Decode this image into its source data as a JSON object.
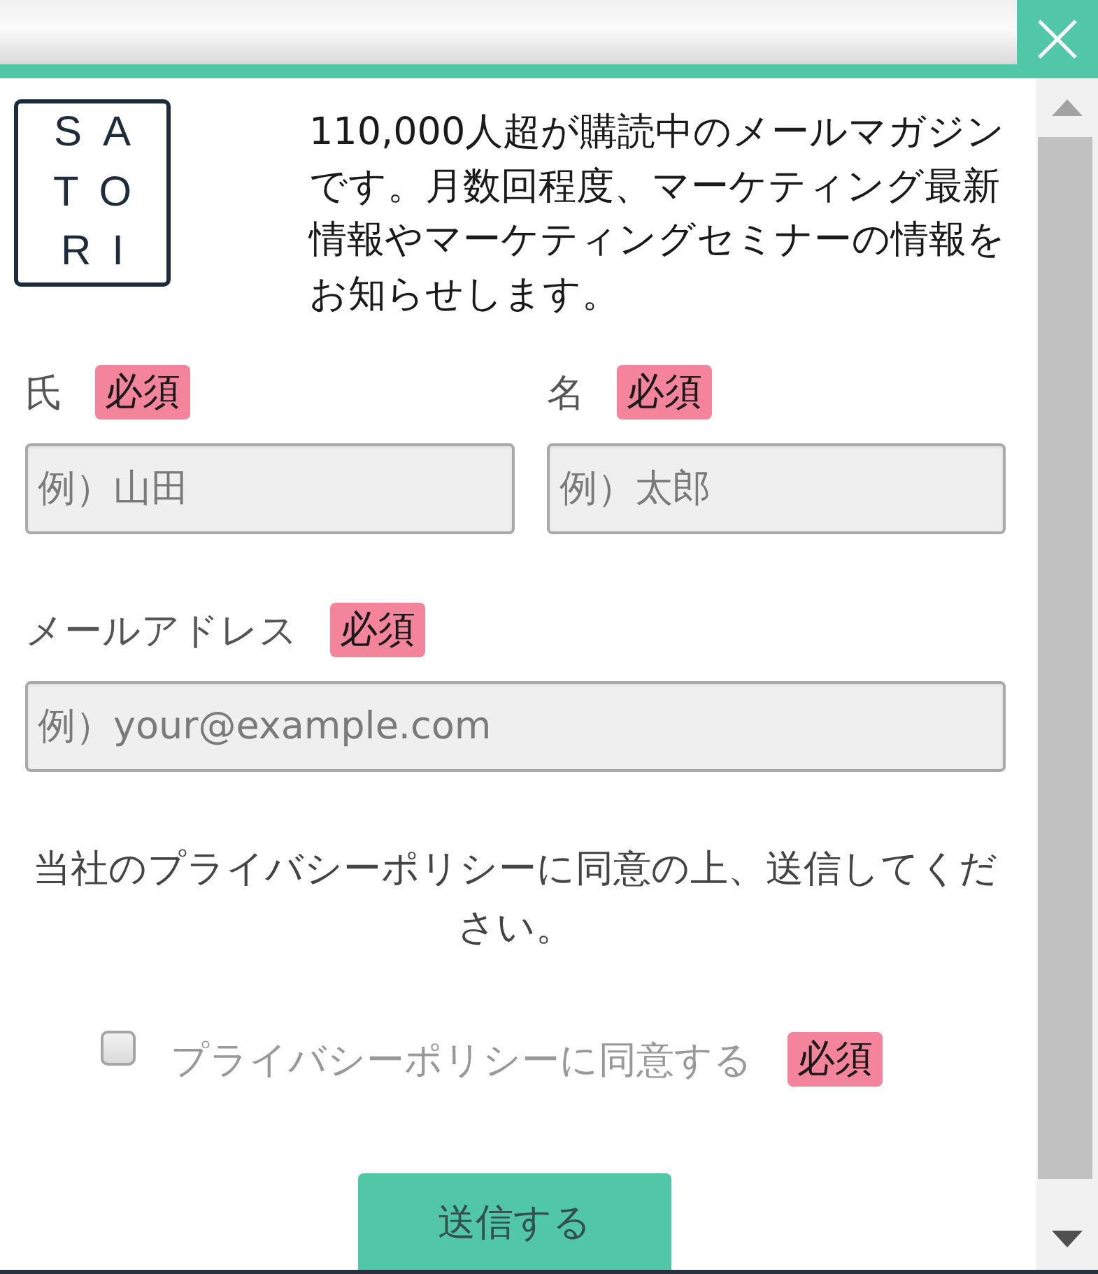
{
  "logo": {
    "text": "SATORI"
  },
  "intro": "110,000人超が購読中のメールマガジンです。月数回程度、マーケティング最新情報やマーケティングセミナーの情報をお知らせします。",
  "name_fields": [
    {
      "label": "氏",
      "badge": "必須",
      "placeholder": "例）山田"
    },
    {
      "label": "名",
      "badge": "必須",
      "placeholder": "例）太郎"
    }
  ],
  "email_field": {
    "label": "メールアドレス",
    "badge": "必須",
    "placeholder": "例）your@example.com"
  },
  "notice": "当社のプライバシーポリシーに同意の上、送信してください。",
  "consent": {
    "label": "プライバシーポリシーに同意する",
    "badge": "必須",
    "checked": false
  },
  "submit_button": {
    "label": "送信する"
  }
}
